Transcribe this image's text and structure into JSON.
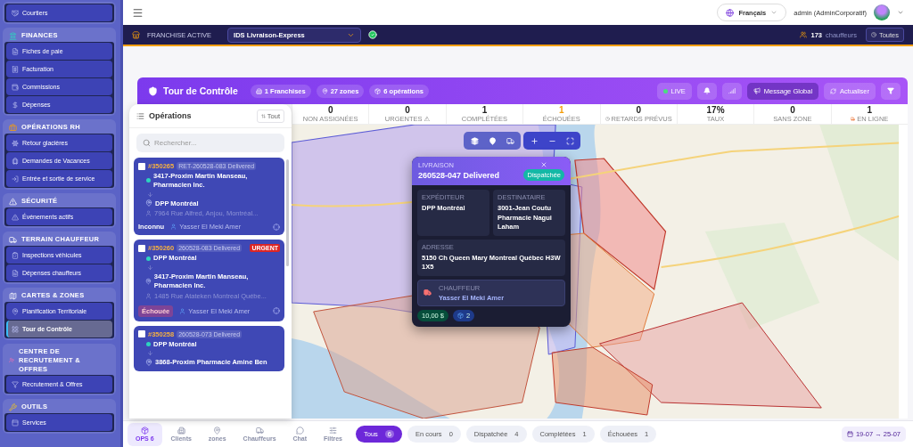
{
  "top_bar": {
    "language": "Français",
    "user": "admin (AdminCorporatif)"
  },
  "franchise_bar": {
    "label": "FRANCHISE ACTIVE",
    "franchise": "IDS Livraison-Express",
    "driver_count": "173",
    "driver_label": "chauffeurs",
    "filter_button": "Toutes"
  },
  "sidebar": {
    "sections": [
      {
        "items": [
          {
            "label": "Courtiers",
            "selected": false
          }
        ]
      },
      {
        "title": "FINANCES",
        "items": [
          {
            "label": "Fiches de paie",
            "selected": false
          },
          {
            "label": "Facturation",
            "selected": false
          },
          {
            "label": "Commissions",
            "selected": false
          },
          {
            "label": "Dépenses",
            "selected": false
          }
        ]
      },
      {
        "title": "OPÉRATIONS RH",
        "items": [
          {
            "label": "Retour glacières",
            "selected": false
          },
          {
            "label": "Demandes de Vacances",
            "selected": false
          },
          {
            "label": "Entrée et sortie de service",
            "selected": false
          }
        ]
      },
      {
        "title": "SÉCURITÉ",
        "items": [
          {
            "label": "Événements actifs",
            "selected": false
          }
        ]
      },
      {
        "title": "TERRAIN CHAUFFEUR",
        "items": [
          {
            "label": "Inspections véhicules",
            "selected": false
          },
          {
            "label": "Dépenses chauffeurs",
            "selected": false
          }
        ]
      },
      {
        "title": "CARTES & ZONES",
        "items": [
          {
            "label": "Planification Territoriale",
            "selected": false
          },
          {
            "label": "Tour de Contrôle",
            "selected": true
          }
        ]
      },
      {
        "title": "CENTRE DE RECRUTEMENT & OFFRES",
        "items": [
          {
            "label": "Recrutement & Offres",
            "selected": false
          }
        ]
      },
      {
        "title": "OUTILS",
        "items": [
          {
            "label": "Services",
            "selected": false
          }
        ]
      }
    ]
  },
  "header": {
    "title": "Tour de Contrôle",
    "chips": [
      "1 Franchises",
      "27 zones",
      "6 opérations"
    ],
    "live": "LIVE",
    "message_button": "Message Global",
    "refresh_button": "Actualiser"
  },
  "stats": [
    {
      "value": "0",
      "label": "NON ASSIGNÉES",
      "kind": "plain"
    },
    {
      "value": "0",
      "label": "URGENTES ⚠",
      "kind": "plain"
    },
    {
      "value": "1",
      "label": "COMPLÉTÉES",
      "kind": "plain"
    },
    {
      "value": "1",
      "label": "ÉCHOUÉES",
      "kind": "alert"
    },
    {
      "value": "0",
      "label": "RETARDS PRÉVUS",
      "kind": "delay"
    },
    {
      "value": "17%",
      "label": "TAUX",
      "kind": "plain"
    },
    {
      "value": "0",
      "label": "SANS ZONE",
      "kind": "plain"
    },
    {
      "value": "1",
      "label": "EN LIGNE",
      "kind": "online"
    }
  ],
  "operations": {
    "title": "Opérations",
    "sort_button": "Tout",
    "search_placeholder": "Rechercher...",
    "cards": [
      {
        "id": "#350265",
        "ref": "RET-260528-083 Delivered",
        "checked": false,
        "origin": "3417-Proxim Martin Manseau, Pharmacien Inc.",
        "destination": "DPP Montréal",
        "address": "7964 Rue Alfred, Anjou, Montréal...",
        "status": "Inconnu",
        "failed": false,
        "driver": "Yasser El Meki Amer"
      },
      {
        "id": "#350260",
        "ref": "260528-083 Delivered",
        "badge": "URGENT",
        "checked": false,
        "origin": "DPP Montréal",
        "destination": "3417-Proxim Martin Manseau, Pharmacien Inc.",
        "address": "1485 Rue Atateken Montreal Québe...",
        "status": "Échouée",
        "failed": true,
        "driver": "Yasser El Meki Amer"
      },
      {
        "id": "#350258",
        "ref": "260528-073 Delivered",
        "checked": false,
        "origin": "DPP Montréal",
        "destination": "3868-Proxim Pharmacie Amine Ben"
      }
    ]
  },
  "popup": {
    "eyebrow": "LIVRAISON",
    "title": "260528-047 Delivered",
    "status": "Dispatchée",
    "sender": {
      "label": "EXPÉDITEUR",
      "value": "DPP Montréal"
    },
    "recipient": {
      "label": "DESTINATAIRE",
      "value": "3001-Jean Coutu Pharmacie Nagui Laham"
    },
    "address": {
      "label": "ADRESSE",
      "value": "5150 Ch Queen Mary Montreal Québec H3W 1X5"
    },
    "driver_label": "CHAUFFEUR",
    "driver": "Yasser El Meki Amer",
    "price": "10,00 $",
    "packages": "2"
  },
  "bottom_bar": {
    "nav": [
      {
        "label": "OPS 6",
        "selected": true
      },
      {
        "label": "Clients",
        "selected": false
      },
      {
        "label": "zones",
        "selected": false
      },
      {
        "label": "Chauffeurs",
        "selected": false
      },
      {
        "label": "Chat",
        "selected": false
      },
      {
        "label": "Filtres",
        "selected": false
      }
    ],
    "filters": [
      {
        "label": "Tous",
        "count": "6",
        "selected": true
      },
      {
        "label": "En cours",
        "count": "0",
        "selected": false
      },
      {
        "label": "Dispatchée",
        "count": "4",
        "selected": false
      },
      {
        "label": "Complétées",
        "count": "1",
        "selected": false
      },
      {
        "label": "Échouées",
        "count": "1",
        "selected": false
      }
    ],
    "date_range": "19-07 → 25-07"
  }
}
